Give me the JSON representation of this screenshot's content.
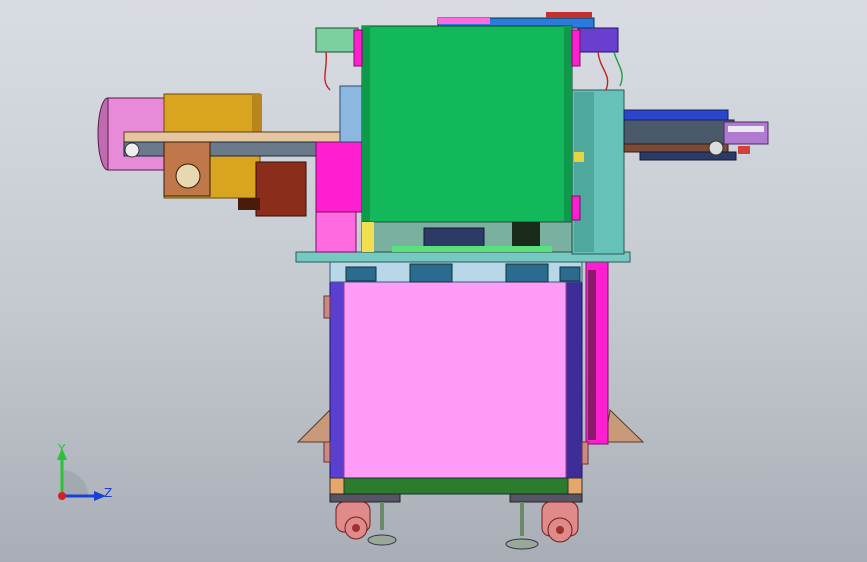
{
  "viewport": {
    "background_top": "#d9dde3",
    "background_bottom": "#a9aeb6"
  },
  "triad": {
    "y_label": "Y",
    "z_label": "Z",
    "y_color": "#2fbf3a",
    "z_color": "#1a3fd6",
    "origin_color": "#d42020"
  },
  "colors": {
    "green_hopper": "#12b85a",
    "pink_cabinet": "#ff9cf7",
    "magenta": "#ff1fd0",
    "teal": "#66c2b8",
    "gold_motor": "#d9a520",
    "pink_roll": "#e78ad8",
    "purple_frame": "#5a3fd0",
    "brown": "#8a2d1b",
    "tan_feet": "#c99a7a",
    "blue_conveyor": "#2b46c8"
  }
}
